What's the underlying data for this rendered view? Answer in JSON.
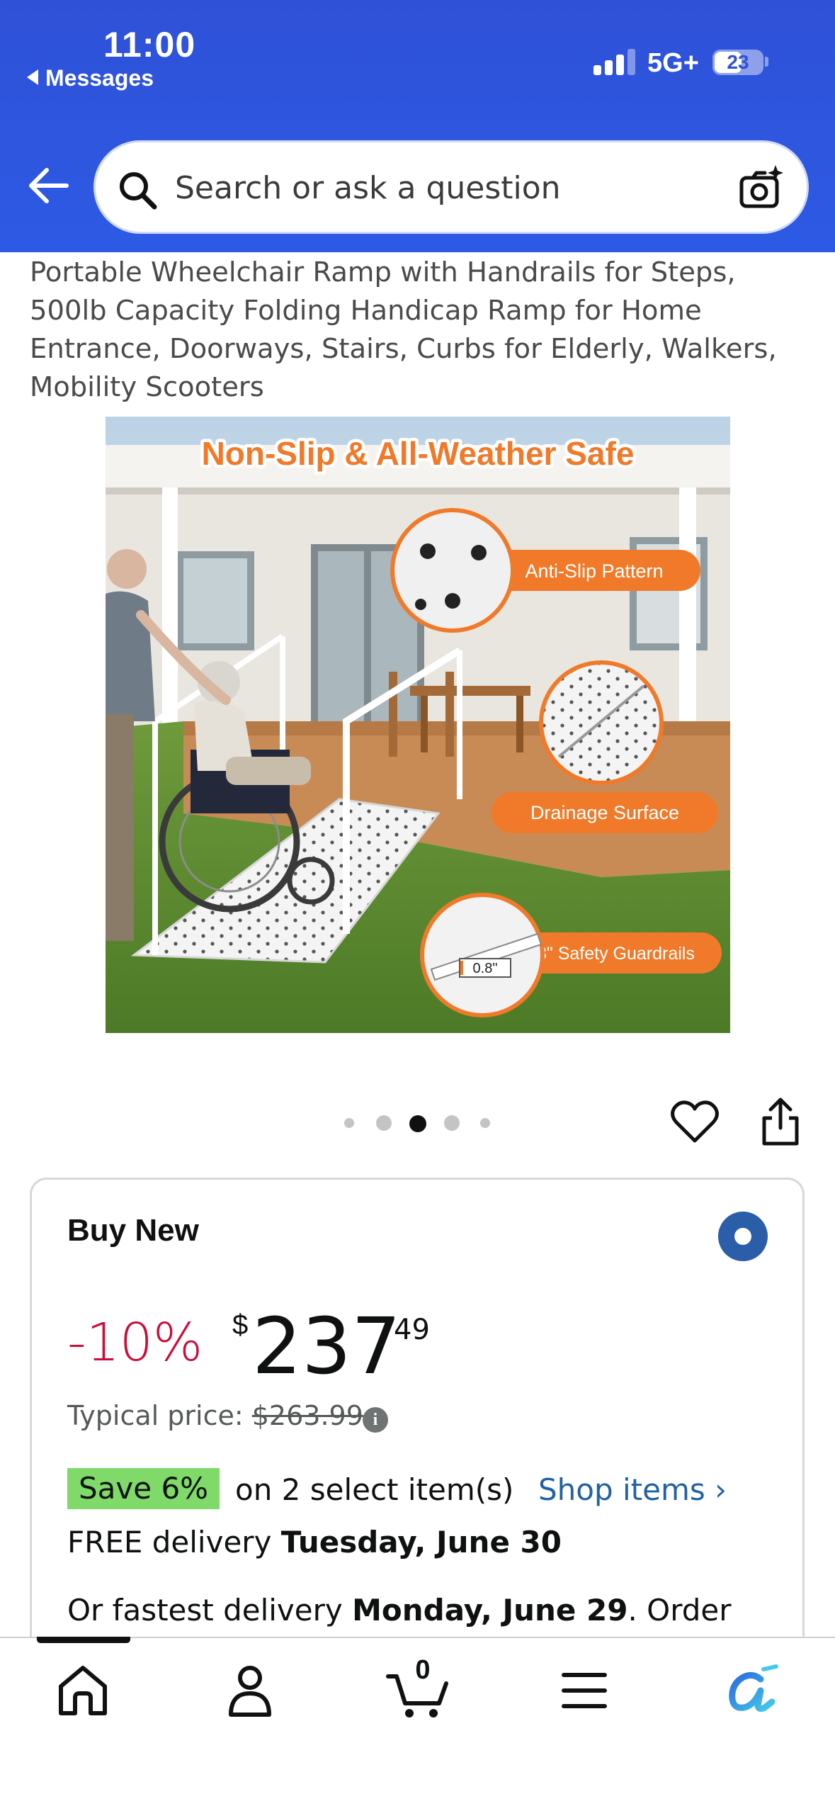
{
  "status_bar": {
    "time": "11:00",
    "back_app": "Messages",
    "network": "5G+",
    "battery": "23"
  },
  "search": {
    "placeholder": "Search or ask a question"
  },
  "product": {
    "title": "Portable Wheelchair Ramp with Handrails for Steps, 500lb Capacity Folding Handicap Ramp for Home Entrance, Doorways, Stairs, Curbs for Elderly, Walkers, Mobility Scooters",
    "image": {
      "headline": "Non-Slip & All-Weather Safe",
      "features": [
        "Anti-Slip Pattern",
        "Drainage Surface",
        "0.8\" Safety Guardrails"
      ],
      "dimension_label": "0.8\""
    },
    "carousel": {
      "count": 5,
      "active_index": 2
    }
  },
  "buy_box": {
    "label": "Buy New",
    "discount": "-10%",
    "currency": "$",
    "price_whole": "237",
    "price_cents": "49",
    "typical_label": "Typical price:",
    "typical_price": "$263.99",
    "info_glyph": "i",
    "save_badge": "Save 6%",
    "save_text": "on 2 select item(s)",
    "shop_link": "Shop items ›",
    "delivery_prefix": "FREE delivery ",
    "delivery_date": "Tuesday, June 30",
    "fastest_prefix": "Or fastest delivery ",
    "fastest_date": "Monday, June 29",
    "fastest_suffix": ". Order"
  },
  "bottom_nav": {
    "items": [
      "home-icon",
      "account-icon",
      "cart-icon",
      "menu-icon",
      "rufus-icon"
    ],
    "cart_count": "0"
  },
  "colors": {
    "header_blue": "#2f51d8",
    "deal_red": "#cc0c39",
    "link_blue": "#2162a1",
    "save_green": "#7fda69",
    "accent_orange": "#f07a2a"
  }
}
